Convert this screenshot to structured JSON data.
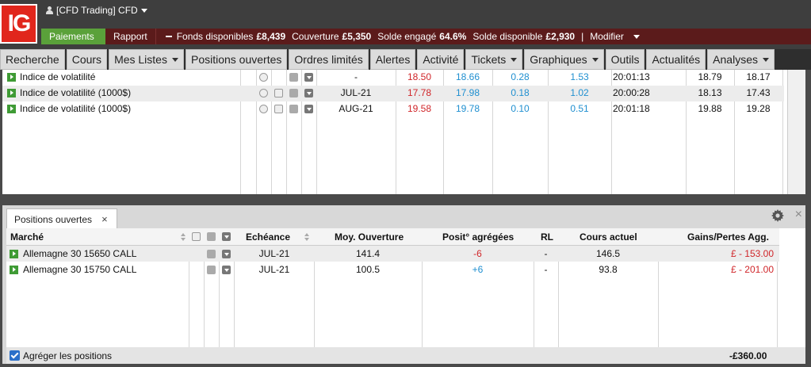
{
  "brand": {
    "logo_text": "IG"
  },
  "account": {
    "label": "[CFD Trading] CFD"
  },
  "funds_bar": {
    "payments": "Paiements",
    "report": "Rapport",
    "available_label": "Fonds disponibles",
    "available_value": "£8,439",
    "coverage_label": "Couverture",
    "coverage_value": "£5,350",
    "committed_label": "Solde engagé",
    "committed_value": "64.6%",
    "balance_label": "Solde disponible",
    "balance_value": "£2,930",
    "separator": "|",
    "modify": "Modifier"
  },
  "nav": [
    {
      "label": "Recherche",
      "dropdown": false
    },
    {
      "label": "Cours",
      "dropdown": false
    },
    {
      "label": "Mes Listes",
      "dropdown": true
    },
    {
      "label": "Positions ouvertes",
      "dropdown": false
    },
    {
      "label": "Ordres limités",
      "dropdown": false
    },
    {
      "label": "Alertes",
      "dropdown": false
    },
    {
      "label": "Activité",
      "dropdown": false
    },
    {
      "label": "Tickets",
      "dropdown": true
    },
    {
      "label": "Graphiques",
      "dropdown": true
    },
    {
      "label": "Outils",
      "dropdown": false
    },
    {
      "label": "Actualités",
      "dropdown": false
    },
    {
      "label": "Analyses",
      "dropdown": true
    }
  ],
  "watchlist": [
    {
      "market": "Indice de volatilité",
      "expiry": "-",
      "sell": "18.50",
      "buy": "18.66",
      "change": "0.28",
      "change_pct": "1.53",
      "time": "20:01:13",
      "high": "18.79",
      "low": "18.17",
      "has_doc": false
    },
    {
      "market": "Indice de volatilité (1000$)",
      "expiry": "JUL-21",
      "sell": "17.78",
      "buy": "17.98",
      "change": "0.18",
      "change_pct": "1.02",
      "time": "20:00:28",
      "high": "18.13",
      "low": "17.43",
      "has_doc": true
    },
    {
      "market": "Indice de volatilité (1000$)",
      "expiry": "AUG-21",
      "sell": "19.58",
      "buy": "19.78",
      "change": "0.10",
      "change_pct": "0.51",
      "time": "20:01:18",
      "high": "19.88",
      "low": "19.28",
      "has_doc": true
    }
  ],
  "positions_panel": {
    "tab_label": "Positions ouvertes",
    "tab_close": "×",
    "close": "×",
    "columns": {
      "market": "Marché",
      "expiry": "Echéance",
      "avg_open": "Moy. Ouverture",
      "aggregated": "Posit° agrégées",
      "rl": "RL",
      "current": "Cours actuel",
      "pnl": "Gains/Pertes Agg."
    },
    "rows": [
      {
        "market": "Allemagne 30 15650 CALL",
        "expiry": "JUL-21",
        "avg_open": "141.4",
        "aggregated": "-6",
        "rl": "-",
        "current": "146.5",
        "pnl": "£ - 153.00"
      },
      {
        "market": "Allemagne 30 15750 CALL",
        "expiry": "JUL-21",
        "avg_open": "100.5",
        "aggregated": "+6",
        "rl": "-",
        "current": "93.8",
        "pnl": "£ - 201.00"
      }
    ],
    "aggregate_label": "Agréger les positions",
    "aggregate_checked": true,
    "total": "-£360.00"
  },
  "colors": {
    "brand_red": "#e1261c",
    "negative": "#d0262a",
    "positive": "#1f8fd0",
    "pay_green": "#5aa13a"
  }
}
